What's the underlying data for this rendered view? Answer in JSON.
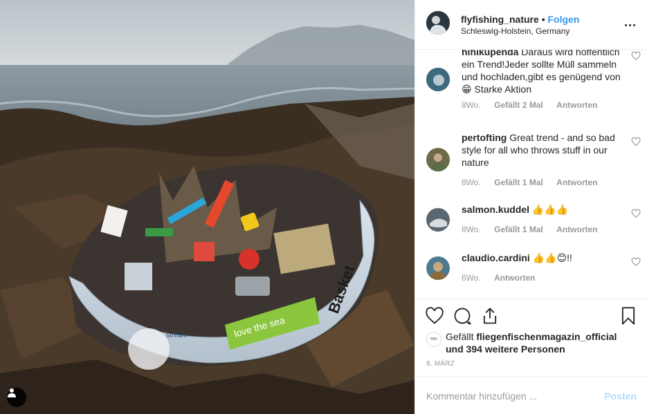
{
  "header": {
    "username": "flyfishing_nature",
    "separator": "•",
    "follow_label": "Folgen",
    "location": "Schleswig-Holstein, Germany"
  },
  "comments": [
    {
      "user": "hihikupenda",
      "text": "Daraus wird hoffentlich ein Trend!Jeder sollte Müll sammeln und hochladen,gibt es genügend von 😁 Starke Aktion",
      "age": "8Wo.",
      "likes": "Gefällt 2 Mal",
      "reply": "Antworten"
    },
    {
      "user": "pertofting",
      "text": "Great trend - and so bad style for all who throws stuff in our nature",
      "age": "8Wo.",
      "likes": "Gefällt 1 Mal",
      "reply": "Antworten"
    },
    {
      "user": "salmon.kuddel",
      "text": "👍👍👍",
      "age": "8Wo.",
      "likes": "Gefällt 1 Mal",
      "reply": "Antworten"
    },
    {
      "user": "claudio.cardini",
      "text": "👍👍😊!!",
      "age": "6Wo.",
      "likes": "",
      "reply": "Antworten"
    }
  ],
  "likes": {
    "prefix": "Gefällt",
    "user": "fliegenfischenmagazin_official",
    "suffix": "und 394 weitere Personen"
  },
  "date": "8. März",
  "add_comment": {
    "placeholder": "Kommentar hinzufügen ...",
    "post_label": "Posten"
  },
  "photo": {
    "bowl_sticker": "love the sea",
    "bowl_brand": "stream",
    "bowl_side": "Basket"
  },
  "colors": {
    "link": "#3897f0",
    "muted": "#999999",
    "post_disabled": "#b3dbff"
  }
}
